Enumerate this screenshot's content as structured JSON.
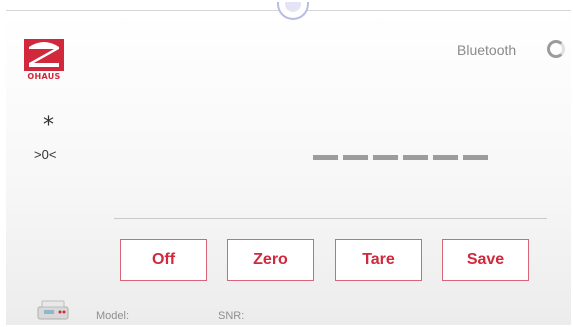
{
  "header": {
    "logo_text": "OHAUS",
    "bluetooth_label": "Bluetooth",
    "bluetooth_status_icon": "spinner-icon"
  },
  "display": {
    "stable_indicator": "*",
    "zero_indicator": ">0<",
    "weight_placeholder": "------"
  },
  "buttons": {
    "off": "Off",
    "zero": "Zero",
    "tare": "Tare",
    "save": "Save"
  },
  "footer": {
    "model_label": "Model:",
    "snr_label": "SNR:"
  },
  "colors": {
    "brand_red": "#d1283b",
    "button_border": "#d9657a",
    "muted_text": "#8a8a8a"
  }
}
